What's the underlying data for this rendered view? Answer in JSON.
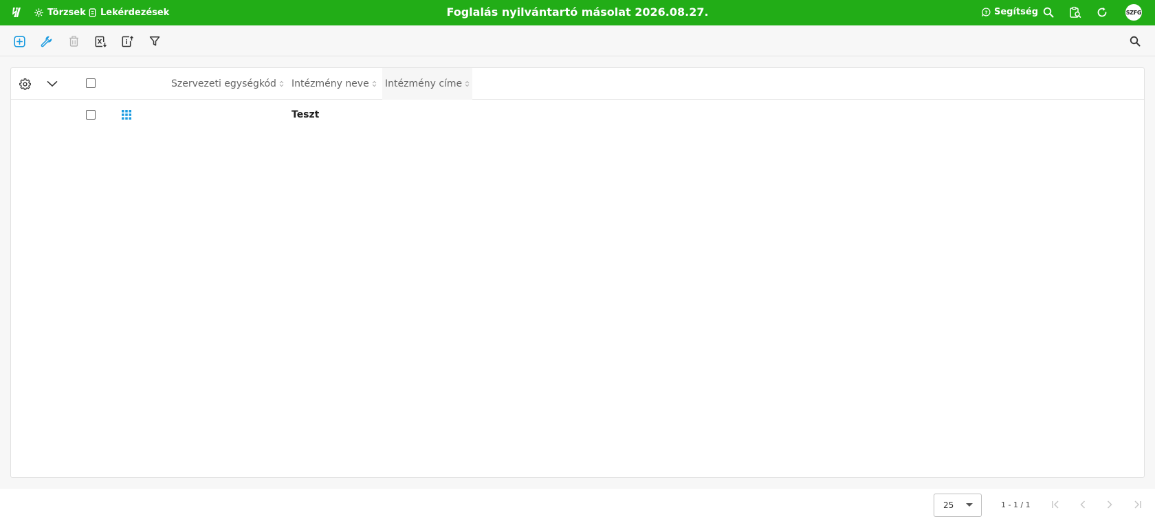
{
  "header": {
    "title": "Foglalás nyilvántartó másolat 2026.08.27.",
    "nav": [
      {
        "label": "Törzsek",
        "icon": "sun-icon"
      },
      {
        "label": "Lekérdezések",
        "icon": "document-icon"
      }
    ],
    "help_label": "Segítség",
    "avatar_initials": "SZFG",
    "brand_color": "#22ad17"
  },
  "toolbar": {
    "icons": [
      "add-icon",
      "wrench-icon",
      "trash-icon",
      "excel-export-icon",
      "info-export-icon",
      "filter-icon",
      "search-icon"
    ],
    "accent_color": "#1a9be0"
  },
  "table": {
    "columns": [
      {
        "label": "Szervezeti egységkód"
      },
      {
        "label": "Intézmény neve"
      },
      {
        "label": "Intézmény címe"
      }
    ],
    "rows": [
      {
        "szervezeti_egysegkod": "",
        "intezmeny_neve": "Teszt",
        "intezmeny_cime": ""
      }
    ]
  },
  "pagination": {
    "page_size": "25",
    "range": "1 - 1 / 1"
  }
}
